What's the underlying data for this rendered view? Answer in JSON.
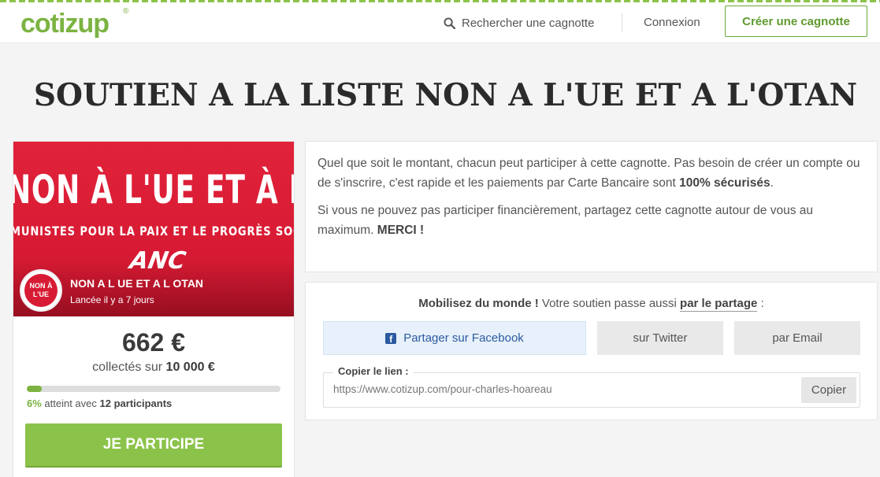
{
  "header": {
    "logo_text": "cotizup",
    "logo_reg": "®",
    "search_label": "Rechercher une cagnotte",
    "login_label": "Connexion",
    "create_label": "Créer une cagnotte"
  },
  "page_title": "SOUTIEN A LA LISTE NON A L'UE ET A L'OTAN",
  "campaign": {
    "banner_line1": "NON À L'UE ET À L'OTAN",
    "banner_line2": "MUNISTES POUR LA PAIX ET LE PROGRÈS SOCIAL",
    "banner_logo": "ANC",
    "avatar_text": "NON À L'UE",
    "name": "NON A L UE ET A L OTAN",
    "launched": "Lancée il y a 7 jours",
    "amount": "662 €",
    "collected_prefix": "collectés sur ",
    "goal": "10 000 €",
    "progress_percent": 6,
    "percent_label": "6%",
    "reached_text": " atteint avec ",
    "participants_count": "12",
    "participants_label": " participants",
    "participate_label": "JE PARTICIPE"
  },
  "info": {
    "p1_text": "Quel que soit le montant, chacun peut participer à cette cagnotte. Pas besoin de créer un compte ou de s'inscrire, c'est rapide et les paiements par Carte Bancaire sont ",
    "p1_bold": "100% sécurisés",
    "p1_end": ".",
    "p2_text": "Si vous ne pouvez pas participer financièrement, partagez cette cagnotte autour de vous au maximum. ",
    "p2_bold": "MERCI !"
  },
  "share": {
    "mobilize_bold": "Mobilisez du monde !",
    "mobilize_text": " Votre soutien passe aussi ",
    "mobilize_link": "par le partage",
    "mobilize_end": " :",
    "facebook_label": "Partager sur Facebook",
    "twitter_label": "sur Twitter",
    "email_label": "par Email",
    "copy_legend": "Copier le lien :",
    "url": "https://www.cotizup.com/pour-charles-hoareau",
    "copy_button": "Copier"
  },
  "colors": {
    "brand_green": "#7cb342",
    "banner_red": "#d81b34",
    "facebook_blue": "#2b5aa0"
  }
}
